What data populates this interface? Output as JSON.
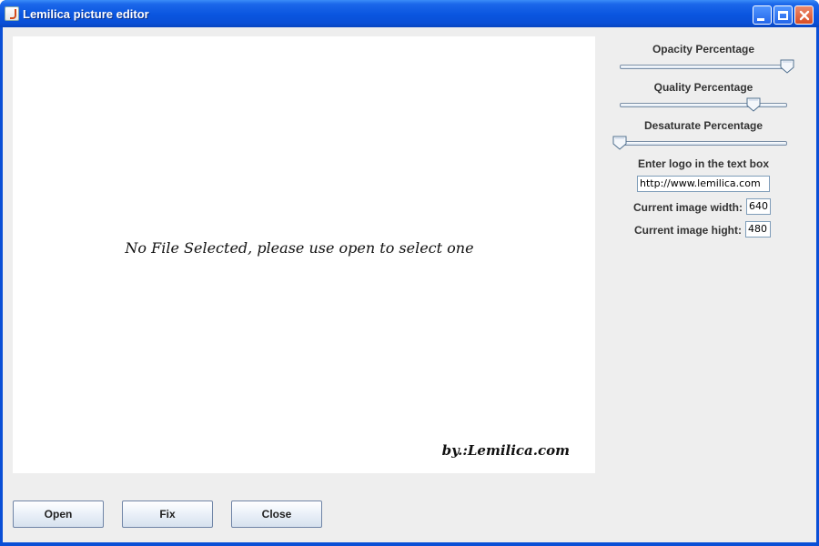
{
  "window": {
    "title": "Lemilica picture editor"
  },
  "canvas": {
    "message": "No File Selected, please use open to select one",
    "credit": "by.:Lemilica.com"
  },
  "controls": {
    "opacity": {
      "label": "Opacity Percentage",
      "value_percent": 100
    },
    "quality": {
      "label": "Quality Percentage",
      "value_percent": 80
    },
    "desaturate": {
      "label": "Desaturate Percentage",
      "value_percent": 0
    },
    "logo": {
      "label": "Enter logo in the text box",
      "value": "http://www.lemilica.com"
    },
    "width": {
      "label": "Current image width:",
      "value": "640"
    },
    "height": {
      "label": "Current image hight:",
      "value": "480"
    }
  },
  "buttons": {
    "open": "Open",
    "fix": "Fix",
    "close": "Close"
  },
  "colors": {
    "titlebar": "#0a4fd6",
    "client_bg": "#eeeeee",
    "canvas_bg": "#ffffff"
  }
}
